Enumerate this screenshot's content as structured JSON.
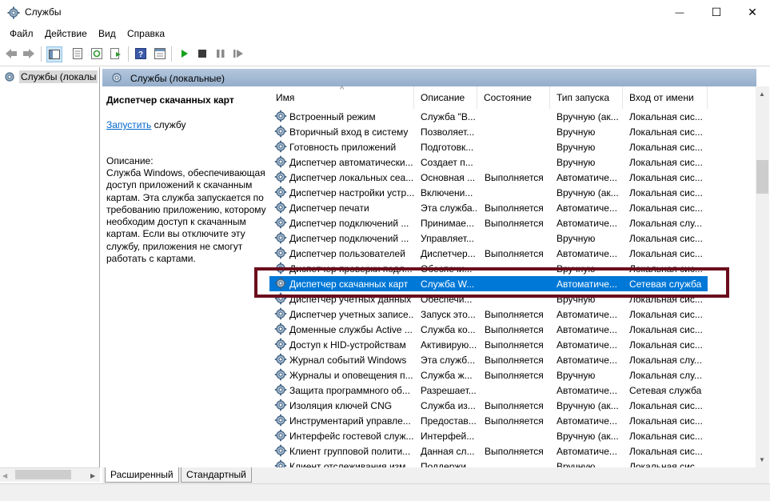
{
  "window": {
    "title": "Службы",
    "minimize_glyph": "—",
    "maximize_glyph": "☐",
    "close_glyph": "✕"
  },
  "menu": [
    "Файл",
    "Действие",
    "Вид",
    "Справка"
  ],
  "toolbar_icons": [
    "back-arrow-icon",
    "forward-arrow-icon",
    "console-tree-icon",
    "properties-icon",
    "refresh-icon",
    "export-list-icon",
    "help-icon",
    "view-icon",
    "start-service-icon",
    "stop-service-icon",
    "pause-service-icon",
    "restart-service-icon"
  ],
  "tree": {
    "root_label": "Службы (локалы"
  },
  "header": {
    "title": "Службы (локальные)"
  },
  "detail": {
    "service_name": "Диспетчер скачанных карт",
    "start_link": "Запустить",
    "start_suffix": " службу",
    "description_heading": "Описание:",
    "description": "Служба Windows, обеспечивающая доступ приложений к скачанным картам. Эта служба запускается по требованию приложению, которому необходим доступ к скачанным картам. Если вы отключите эту службу, приложения не смогут работать с картами."
  },
  "columns": {
    "sort_indicator": "^",
    "name": "Имя",
    "description": "Описание",
    "status": "Состояние",
    "startup": "Тип запуска",
    "logon": "Вход от имени"
  },
  "rows": [
    {
      "name": "Встроенный режим",
      "desc": "Служба \"В...",
      "status": "",
      "startup": "Вручную (ак...",
      "logon": "Локальная сис..."
    },
    {
      "name": "Вторичный вход в систему",
      "desc": "Позволяет...",
      "status": "",
      "startup": "Вручную",
      "logon": "Локальная сис..."
    },
    {
      "name": "Готовность приложений",
      "desc": "Подготовк...",
      "status": "",
      "startup": "Вручную",
      "logon": "Локальная сис..."
    },
    {
      "name": "Диспетчер автоматически...",
      "desc": "Создает п...",
      "status": "",
      "startup": "Вручную",
      "logon": "Локальная сис..."
    },
    {
      "name": "Диспетчер локальных сеа...",
      "desc": "Основная ...",
      "status": "Выполняется",
      "startup": "Автоматиче...",
      "logon": "Локальная сис..."
    },
    {
      "name": "Диспетчер настройки устр...",
      "desc": "Включени...",
      "status": "",
      "startup": "Вручную (ак...",
      "logon": "Локальная сис..."
    },
    {
      "name": "Диспетчер печати",
      "desc": "Эта служба...",
      "status": "Выполняется",
      "startup": "Автоматиче...",
      "logon": "Локальная сис..."
    },
    {
      "name": "Диспетчер подключений ...",
      "desc": "Принимае...",
      "status": "Выполняется",
      "startup": "Автоматиче...",
      "logon": "Локальная слу..."
    },
    {
      "name": "Диспетчер подключений ...",
      "desc": "Управляет...",
      "status": "",
      "startup": "Вручную",
      "logon": "Локальная сис..."
    },
    {
      "name": "Диспетчер пользователей",
      "desc": "Диспетчер...",
      "status": "Выполняется",
      "startup": "Автоматиче...",
      "logon": "Локальная сис..."
    },
    {
      "name": "Диспетчер проверки подл...",
      "desc": "Обеспечи...",
      "status": "",
      "startup": "Вручную",
      "logon": "Локальная сис..."
    },
    {
      "name": "Диспетчер скачанных карт",
      "desc": "Служба W...",
      "status": "",
      "startup": "Автоматиче...",
      "logon": "Сетевая служба",
      "selected": true
    },
    {
      "name": "Диспетчер учетных данных",
      "desc": "Обеспечи...",
      "status": "",
      "startup": "Вручную",
      "logon": "Локальная сис..."
    },
    {
      "name": "Диспетчер учетных записе...",
      "desc": "Запуск это...",
      "status": "Выполняется",
      "startup": "Автоматиче...",
      "logon": "Локальная сис..."
    },
    {
      "name": "Доменные службы Active ...",
      "desc": "Служба ко...",
      "status": "Выполняется",
      "startup": "Автоматиче...",
      "logon": "Локальная сис..."
    },
    {
      "name": "Доступ к HID-устройствам",
      "desc": "Активирую...",
      "status": "Выполняется",
      "startup": "Автоматиче...",
      "logon": "Локальная сис..."
    },
    {
      "name": "Журнал событий Windows",
      "desc": "Эта служб...",
      "status": "Выполняется",
      "startup": "Автоматиче...",
      "logon": "Локальная слу..."
    },
    {
      "name": "Журналы и оповещения п...",
      "desc": "Служба ж...",
      "status": "Выполняется",
      "startup": "Вручную",
      "logon": "Локальная слу..."
    },
    {
      "name": "Защита программного об...",
      "desc": "Разрешает...",
      "status": "",
      "startup": "Автоматиче...",
      "logon": "Сетевая служба"
    },
    {
      "name": "Изоляция ключей CNG",
      "desc": "Служба из...",
      "status": "Выполняется",
      "startup": "Вручную (ак...",
      "logon": "Локальная сис..."
    },
    {
      "name": "Инструментарий управле...",
      "desc": "Предостав...",
      "status": "Выполняется",
      "startup": "Автоматиче...",
      "logon": "Локальная сис..."
    },
    {
      "name": "Интерфейс гостевой служ...",
      "desc": "Интерфей...",
      "status": "",
      "startup": "Вручную (ак...",
      "logon": "Локальная сис..."
    },
    {
      "name": "Клиент групповой полити...",
      "desc": "Данная сл...",
      "status": "Выполняется",
      "startup": "Автоматиче...",
      "logon": "Локальная сис..."
    },
    {
      "name": "Клиент отслеживания изм...",
      "desc": "Поддержи...",
      "status": "",
      "startup": "Вручную",
      "logon": "Локальная сис..."
    }
  ],
  "tabs": [
    "Расширенный",
    "Стандартный"
  ],
  "colors": {
    "selection": "#0078d7",
    "header_gradient_top": "#b3c7dd",
    "highlight_frame": "#6b0c1c"
  }
}
